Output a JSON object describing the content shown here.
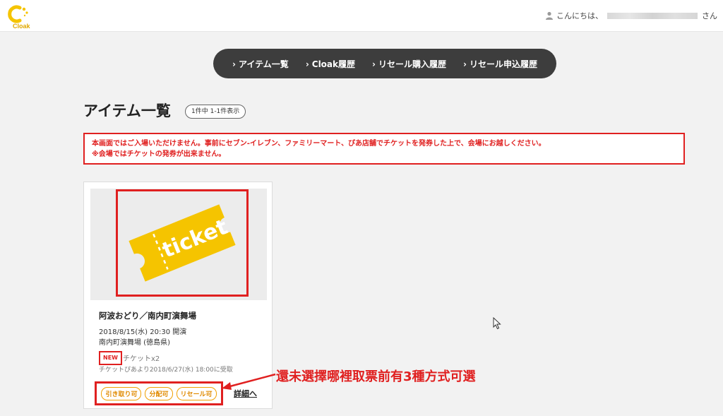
{
  "header": {
    "logo_text": "Cloak",
    "greeting_prefix": "こんにちは、",
    "greeting_suffix": "さん"
  },
  "nav": {
    "items": [
      {
        "label": "アイテム一覧"
      },
      {
        "label": "Cloak履歴"
      },
      {
        "label": "リセール購入履歴"
      },
      {
        "label": "リセール申込履歴"
      }
    ]
  },
  "page": {
    "title": "アイテム一覧",
    "count": "1件中 1-1件表示"
  },
  "warning": {
    "line1": "本画面ではご入場いただけません。事前にセブン-イレブン、ファミリーマート、ぴあ店舗でチケットを発券した上で、会場にお越しください。",
    "line2": "※会場ではチケットの発券が出来ません。"
  },
  "card": {
    "image_text": "ticket",
    "title": "阿波おどり／南内町演舞場",
    "date": "2018/8/15(水) 20:30 開演",
    "venue": "南内町演舞場 (徳島県)",
    "new_badge": "NEW",
    "ticket_count": "チケットx2",
    "receive_info": "チケットぴあより2018/6/27(水) 18:00に受取",
    "tags": [
      "引き取り可",
      "分配可",
      "リセール可"
    ],
    "detail_link": "詳細へ"
  },
  "annotation": {
    "text": "還未選擇哪裡取票前有3種方式可選"
  },
  "colors": {
    "brand": "#f5c400",
    "alert_red": "#e02020",
    "nav_bg": "#3d3d3d",
    "tag_orange": "#f0a000"
  }
}
